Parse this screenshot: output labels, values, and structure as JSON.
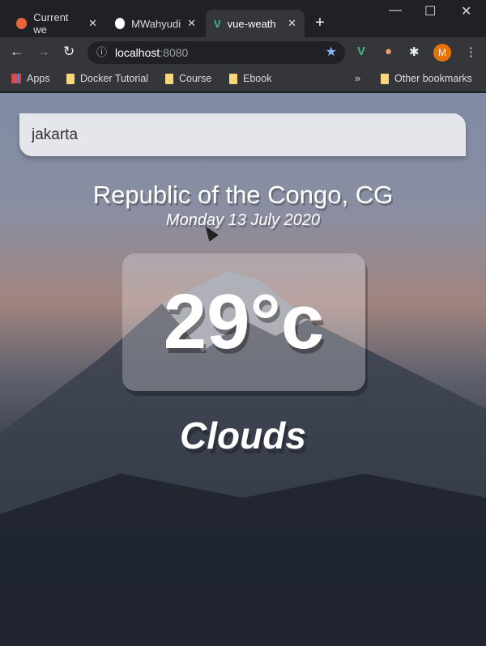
{
  "browser": {
    "tabs": [
      {
        "title": "Current we",
        "favicon": "weather-icon"
      },
      {
        "title": "MWahyudi",
        "favicon": "github-icon"
      },
      {
        "title": "vue-weath",
        "favicon": "vue-icon",
        "active": true
      }
    ],
    "new_tab": "+",
    "url_host": "localhost",
    "url_port": ":8080",
    "profile_initial": "M",
    "bookmarks": [
      "Apps",
      "Docker Tutorial",
      "Course",
      "Ebook"
    ],
    "overflow": "»",
    "other_bookmarks": "Other bookmarks"
  },
  "app": {
    "search_value": "jakarta",
    "location": "Republic of the Congo, CG",
    "date": "Monday 13 July 2020",
    "temperature": "29°c",
    "weather": "Clouds"
  }
}
